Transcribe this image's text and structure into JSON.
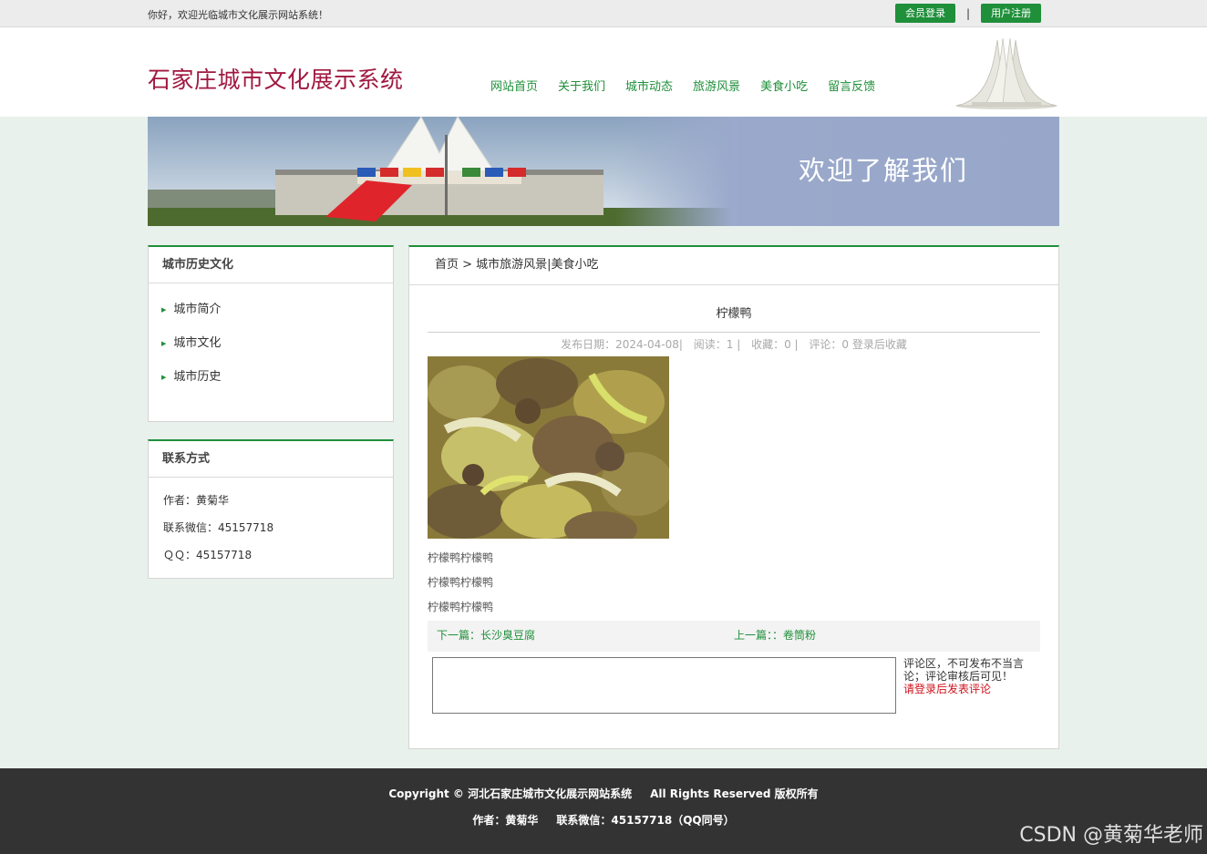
{
  "topbar": {
    "welcome": "你好，欢迎光临城市文化展示网站系统！",
    "login": "会员登录",
    "separator": "|",
    "register": "用户注册"
  },
  "header": {
    "site_title": "石家庄城市文化展示系统",
    "nav": [
      "网站首页",
      "关于我们",
      "城市动态",
      "旅游风景",
      "美食小吃",
      "留言反馈"
    ]
  },
  "banner": {
    "text": "欢迎了解我们"
  },
  "sidebar": {
    "history_title": "城市历史文化",
    "items": [
      "城市简介",
      "城市文化",
      "城市历史"
    ],
    "contact_title": "联系方式",
    "contact": [
      "作者：黄菊华",
      "联系微信：45157718",
      "ＱＱ：45157718"
    ]
  },
  "main": {
    "breadcrumb": "首页 > 城市旅游风景|美食小吃",
    "title": "柠檬鸭",
    "meta": {
      "date": "发布日期：2024-04-08|",
      "reads": "阅读：1 |",
      "favorites": "收藏：0 |",
      "comments": "评论：0 登录后收藏"
    },
    "paragraphs": [
      "柠檬鸭柠檬鸭",
      "柠檬鸭柠檬鸭",
      "柠檬鸭柠檬鸭"
    ],
    "next": "下一篇：长沙臭豆腐",
    "prev": "上一篇：：卷筒粉",
    "comment_note": "评论区，不可发布不当言论；评论审核后可见！",
    "comment_login": "请登录后发表评论"
  },
  "footer": {
    "copyright": "Copyright © 河北石家庄城市文化展示网站系统",
    "rights": "All Rights Reserved 版权所有",
    "author": "作者：黄菊华",
    "wechat": "联系微信：45157718（QQ同号）"
  },
  "watermark": "CSDN @黄菊华老师",
  "colors": {
    "accent": "#1f8f3a",
    "title": "#a0183f",
    "footer": "#333333",
    "alert": "#d0121b"
  }
}
